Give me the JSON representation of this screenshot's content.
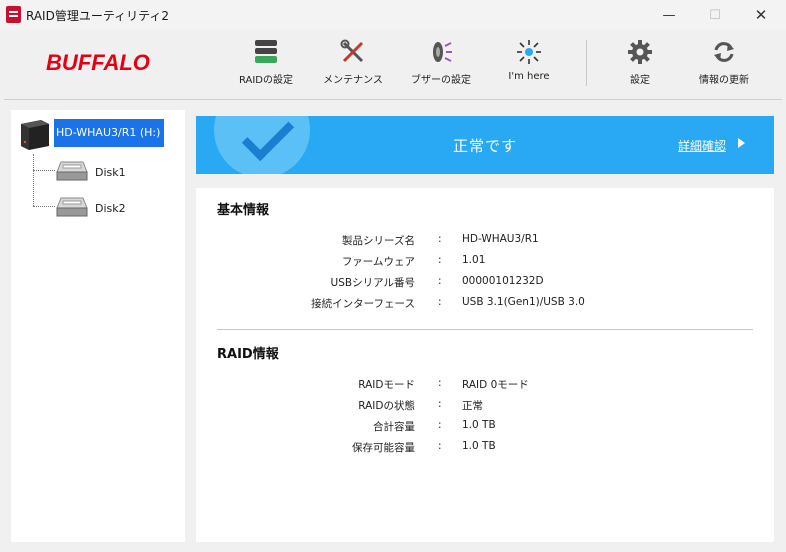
{
  "window": {
    "title": "RAID管理ユーティリティ2",
    "controls": {
      "minimize": "—",
      "maximize": "☐",
      "close": "✕"
    }
  },
  "toolbar": {
    "logo": "BUFFALO",
    "items": [
      {
        "label": "RAIDの設定",
        "icon": "database-icon"
      },
      {
        "label": "メンテナンス",
        "icon": "tools-icon"
      },
      {
        "label": "ブザーの設定",
        "icon": "buzzer-icon"
      },
      {
        "label": "I'm here",
        "icon": "locate-icon"
      },
      {
        "label": "設定",
        "icon": "gear-icon"
      },
      {
        "label": "情報の更新",
        "icon": "refresh-icon"
      }
    ]
  },
  "tree": {
    "device": "HD-WHAU3/R1 (H:)",
    "disks": [
      "Disk1",
      "Disk2"
    ]
  },
  "banner": {
    "status": "正常です",
    "link": "詳細確認"
  },
  "basic_info": {
    "title": "基本情報",
    "rows": [
      {
        "key": "製品シリーズ名",
        "sep": ":",
        "value": "HD-WHAU3/R1"
      },
      {
        "key": "ファームウェア",
        "sep": ":",
        "value": "1.01"
      },
      {
        "key": "USBシリアル番号",
        "sep": ":",
        "value": "00000101232D"
      },
      {
        "key": "接続インターフェース",
        "sep": ":",
        "value": "USB 3.1(Gen1)/USB 3.0"
      }
    ]
  },
  "raid_info": {
    "title": "RAID情報",
    "rows": [
      {
        "key": "RAIDモード",
        "sep": ":",
        "value": "RAID 0モード"
      },
      {
        "key": "RAIDの状態",
        "sep": ":",
        "value": "正常"
      },
      {
        "key": "合計容量",
        "sep": ":",
        "value": "1.0 TB"
      },
      {
        "key": "保存可能容量",
        "sep": ":",
        "value": "1.0 TB"
      }
    ]
  },
  "colors": {
    "banner": "#29a8f4",
    "selection": "#1a73e8",
    "logo": "#e60012"
  }
}
